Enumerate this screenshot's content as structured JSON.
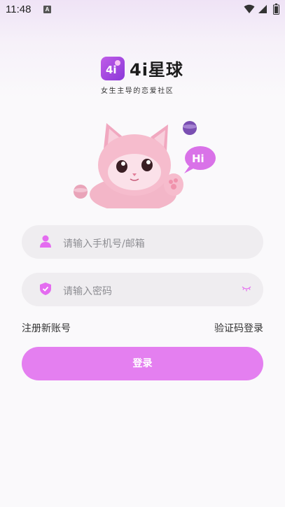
{
  "status_bar": {
    "time": "11:48",
    "notification_letter": "A"
  },
  "brand": {
    "name": "4i星球",
    "slogan": "女生主导的恋爱社区",
    "logo_mark": "4i"
  },
  "mascot": {
    "speech_bubble": "Hi"
  },
  "form": {
    "phone_placeholder": "请输入手机号/邮箱",
    "password_placeholder": "请输入密码"
  },
  "links": {
    "register": "注册新账号",
    "sms_login": "验证码登录"
  },
  "login_button": "登录",
  "colors": {
    "accent": "#e47ff0",
    "field_bg": "#efedf0",
    "icon": "#e46cf0"
  }
}
